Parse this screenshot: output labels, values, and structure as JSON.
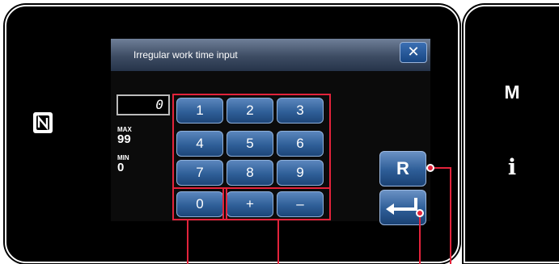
{
  "dialog": {
    "title": "Irregular work time input",
    "close": "✕"
  },
  "display": {
    "value": "0"
  },
  "range": {
    "max_label": "MAX",
    "max_value": "99",
    "min_label": "MIN",
    "min_value": "0"
  },
  "keypad": {
    "keys": [
      "1",
      "2",
      "3",
      "4",
      "5",
      "6",
      "7",
      "8",
      "9",
      "0",
      "+",
      "–"
    ]
  },
  "side": {
    "m_label": "M",
    "i_label": "i"
  },
  "actions": {
    "reset_label": "R",
    "enter_icon": "enter-arrow-icon"
  },
  "colors": {
    "callout": "#e3233b",
    "key_blue": "#2f5f98"
  }
}
